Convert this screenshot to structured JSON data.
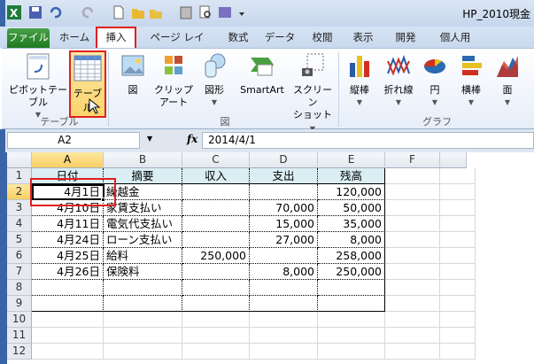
{
  "window": {
    "title": "HP_2010現金"
  },
  "tabs": [
    "ファイル",
    "ホーム",
    "挿入",
    "ページ レイアウト",
    "数式",
    "データ",
    "校閲",
    "表示",
    "開発",
    "個人用"
  ],
  "ribbon": {
    "buttons": [
      "ピボットテーブル",
      "テーブル",
      "図",
      "クリップ",
      "アート",
      "図形",
      "SmartArt",
      "スクリーン",
      "ショット",
      "縦棒",
      "折れ線",
      "円",
      "横棒",
      "面"
    ],
    "groups": [
      "テーブル",
      "図",
      "グラフ"
    ]
  },
  "formula_bar": {
    "name_box": "A2",
    "fx": "fx",
    "formula": "2014/4/1"
  },
  "sheet": {
    "columns": [
      "A",
      "B",
      "C",
      "D",
      "E",
      "F"
    ],
    "rows": [
      "1",
      "2",
      "3",
      "4",
      "5",
      "6",
      "7",
      "8",
      "9",
      "10",
      "11",
      "12"
    ],
    "header": [
      "日付",
      "摘要",
      "収入",
      "支出",
      "残高"
    ],
    "data": [
      [
        "4月1日",
        "繰越金",
        "",
        "",
        "120,000"
      ],
      [
        "4月10日",
        "家賃支払い",
        "",
        "70,000",
        "50,000"
      ],
      [
        "4月11日",
        "電気代支払い",
        "",
        "15,000",
        "35,000"
      ],
      [
        "4月24日",
        "ローン支払い",
        "",
        "27,000",
        "8,000"
      ],
      [
        "4月25日",
        "給料",
        "250,000",
        "",
        "258,000"
      ],
      [
        "4月26日",
        "保険料",
        "",
        "8,000",
        "250,000"
      ]
    ]
  }
}
